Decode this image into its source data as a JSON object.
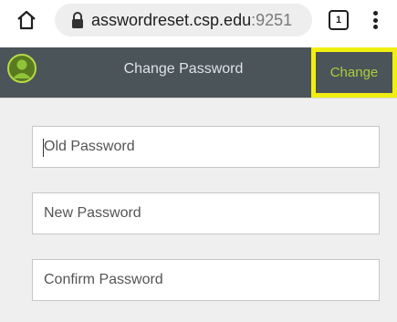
{
  "browser": {
    "url_host": "asswordreset.csp.edu",
    "url_port": ":9251",
    "tab_count": "1",
    "icons": [
      "home-icon",
      "lock-icon",
      "tab-switcher-icon",
      "overflow-menu-icon"
    ]
  },
  "header": {
    "title": "Change Password",
    "action_label": "Change",
    "avatar_icon": "user-avatar-icon",
    "colors": {
      "bar": "#4a5459",
      "action_text": "#a9cf3c",
      "highlight": "#f1ef10"
    }
  },
  "form": {
    "old_password_placeholder": "Old Password",
    "new_password_placeholder": "New Password",
    "confirm_password_placeholder": "Confirm Password",
    "background": "#efefef"
  }
}
